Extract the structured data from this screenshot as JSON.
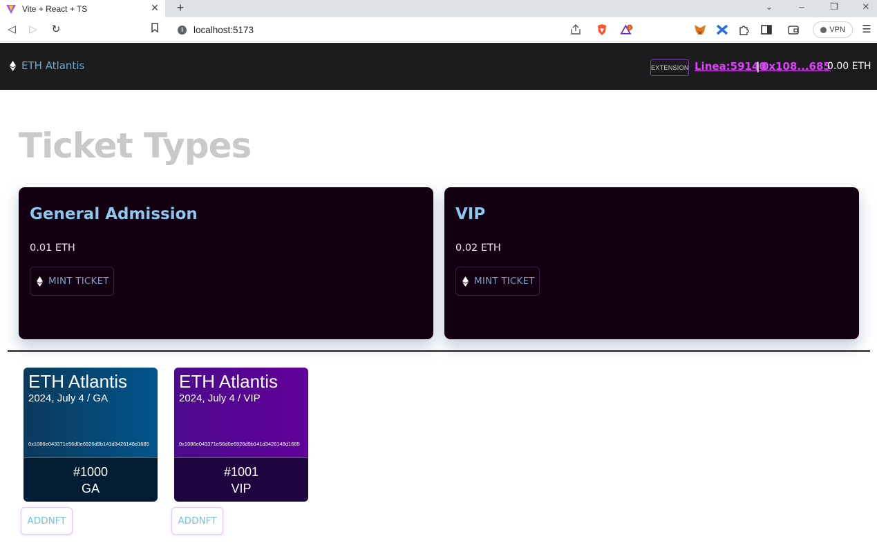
{
  "browser": {
    "tab_title": "Vite + React + TS",
    "url": "localhost:5173",
    "vpn_label": "VPN",
    "brave_badge_count": "2"
  },
  "header": {
    "logo_text": "ETH Atlantis",
    "extension_badge": "EXTENSION",
    "network": "Linea:59140",
    "separator": "|",
    "address": "0x108...685",
    "balance": "0.00 ETH"
  },
  "page": {
    "title": "Ticket Types"
  },
  "ticket_types": [
    {
      "name": "General Admission",
      "price": "0.01 ETH",
      "button": "MINT TICKET"
    },
    {
      "name": "VIP",
      "price": "0.02 ETH",
      "button": "MINT TICKET"
    }
  ],
  "nfts": [
    {
      "title": "ETH Atlantis",
      "subtitle": "2024, July 4 / GA",
      "hash": "0x1086e043371e56d0e6926d9b141d3426148d1685",
      "number": "#1000",
      "kind": "GA",
      "button": "ADDNFT",
      "colors": {
        "top_start": "#0b3a5c",
        "top_end": "#01558c",
        "bottom": "#021d33"
      }
    },
    {
      "title": "ETH Atlantis",
      "subtitle": "2024, July 4 / VIP",
      "hash": "0x1086e043371e56d0e6926d9b141d3426148d1685",
      "number": "#1001",
      "kind": "VIP",
      "button": "ADDNFT",
      "colors": {
        "top_start": "#4b0a8c",
        "top_end": "#62009a",
        "bottom": "#1e0540"
      }
    }
  ],
  "colors": {
    "header_bg": "#1c1c1e",
    "accent_link": "#e040fb",
    "card_bg": "#130010",
    "card_title": "#8fc8ef"
  }
}
